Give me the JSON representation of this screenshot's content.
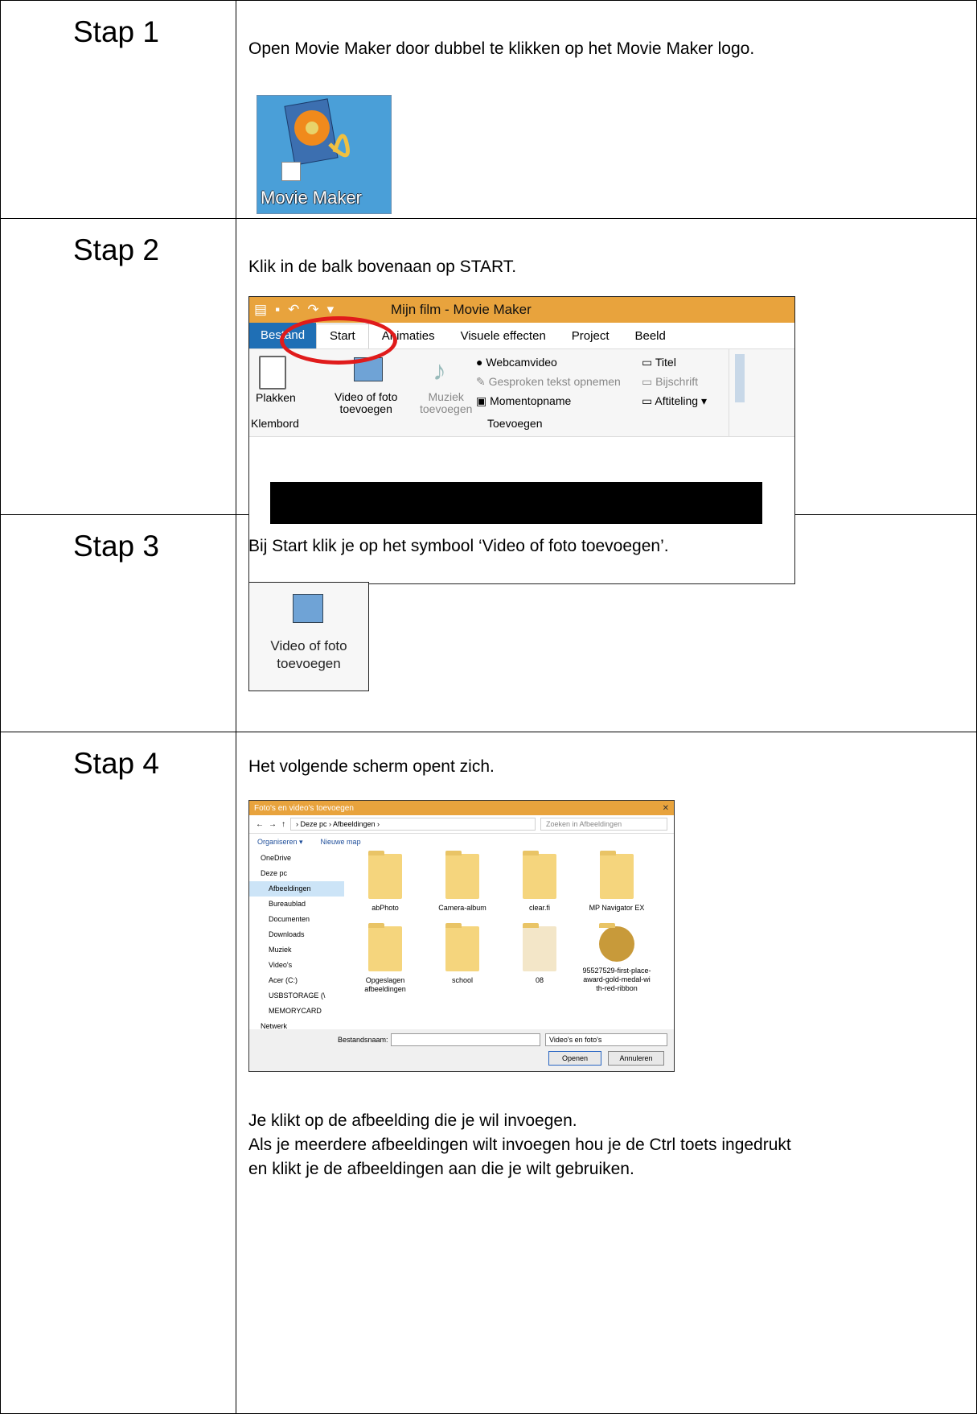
{
  "steps": [
    {
      "label": "Stap 1",
      "text": "Open Movie Maker door dubbel te klikken op het Movie Maker logo.",
      "logo_label": "Movie Maker"
    },
    {
      "label": "Stap 2",
      "text": "Klik in de balk bovenaan op START."
    },
    {
      "label": "Stap 3",
      "text": "Bij Start klik je op het symbool ‘Video of foto toevoegen’."
    },
    {
      "label": "Stap 4",
      "text": "Het volgende scherm opent zich.",
      "outro": [
        "Je klikt op de afbeelding die je wil invoegen.",
        "Als je meerdere afbeeldingen wilt invoegen hou je de Ctrl toets ingedrukt",
        "en klikt je de afbeeldingen aan die je wilt gebruiken."
      ]
    }
  ],
  "ribbon": {
    "title": "Mijn film - Movie Maker",
    "tabs": [
      "Bestand",
      "Start",
      "Animaties",
      "Visuele effecten",
      "Project",
      "Beeld"
    ],
    "plakken": "Plakken",
    "video_foto": [
      "Video of foto",
      "toevoegen"
    ],
    "muziek": [
      "Muziek",
      "toevoegen"
    ],
    "webcam": "Webcamvideo",
    "gesproken": "Gesproken tekst opnemen",
    "momentopname": "Momentopname",
    "titel": "Titel",
    "bijschrift": "Bijschrift",
    "aftiteling": "Aftiteling",
    "group_klembord": "Klembord",
    "group_toevoegen": "Toevoegen"
  },
  "step3_button": [
    "Video of foto",
    "toevoegen"
  ],
  "dialog": {
    "title": "Foto's en video's toevoegen",
    "path": "› Deze pc › Afbeeldingen ›",
    "search": "Zoeken in Afbeeldingen",
    "organiseren": "Organiseren ▾",
    "nieuwe_map": "Nieuwe map",
    "nav": [
      "OneDrive",
      "Deze pc",
      "Afbeeldingen",
      "Bureaublad",
      "Documenten",
      "Downloads",
      "Muziek",
      "Video's",
      "Acer (C:)",
      "USBSTORAGE (\\",
      "MEMORYCARD",
      "Netwerk"
    ],
    "tiles": [
      "abPhoto",
      "Camera-album",
      "clear.fi",
      "MP Navigator EX",
      "Opgeslagen afbeeldingen",
      "school",
      "08",
      "95527529-first-place-award-gold-medal-with-red-ribbon"
    ],
    "filename_label": "Bestandsnaam:",
    "filetype": "Video's en foto's",
    "open": "Openen",
    "cancel": "Annuleren"
  }
}
